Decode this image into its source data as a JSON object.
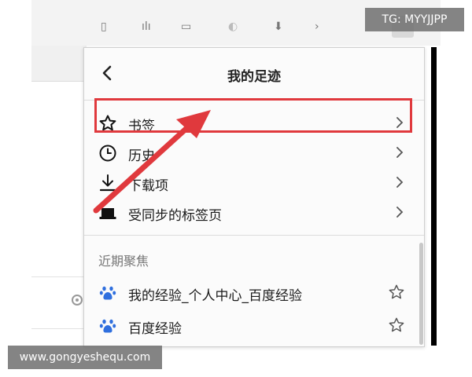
{
  "panel": {
    "title": "我的足迹",
    "items": [
      {
        "label": "书签",
        "icon": "star-icon"
      },
      {
        "label": "历史",
        "icon": "clock-icon"
      },
      {
        "label": "下载项",
        "icon": "download-icon"
      },
      {
        "label": "受同步的标签页",
        "icon": "laptop-icon"
      }
    ],
    "recent_title": "近期聚焦",
    "recent_items": [
      {
        "label": "我的经验_个人中心_百度经验",
        "icon": "baidu-paw-icon"
      },
      {
        "label": "百度经验",
        "icon": "baidu-paw-icon"
      }
    ]
  },
  "colors": {
    "highlight": "#e0393d",
    "baidu_blue": "#2f6fde"
  },
  "watermarks": {
    "top_right": "TG: MYYJJPP",
    "bottom_left": "www.gongyeshequ.com"
  }
}
